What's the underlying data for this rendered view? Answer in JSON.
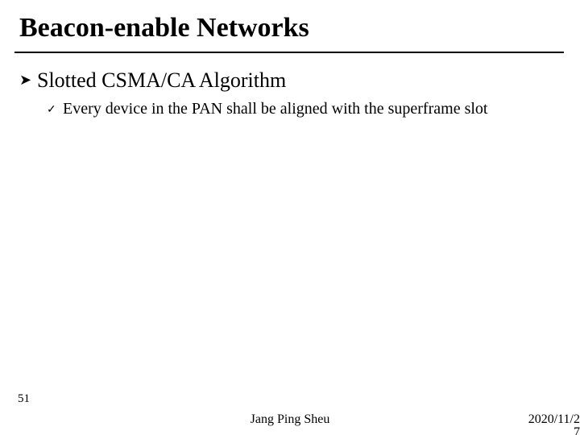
{
  "title": "Beacon-enable Networks",
  "bullets": {
    "lvl1": {
      "marker": "➤",
      "text": "Slotted CSMA/CA Algorithm"
    },
    "lvl2": {
      "marker": "✓",
      "text": "Every device in the PAN shall be aligned with the superframe slot"
    }
  },
  "footer": {
    "page": "51",
    "author": "Jang Ping Sheu",
    "date_line1": "2020/11/2",
    "date_line2": "7"
  }
}
